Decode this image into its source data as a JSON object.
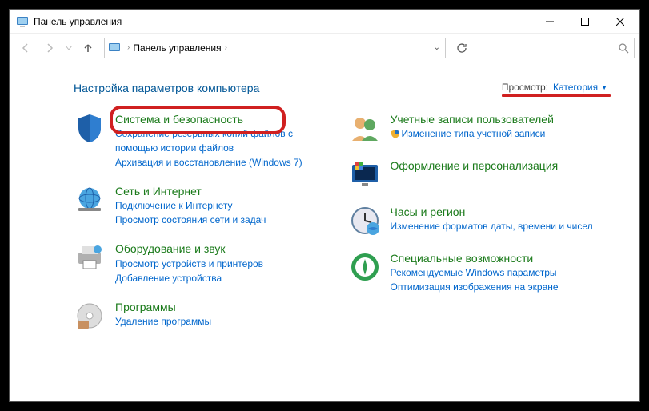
{
  "window": {
    "title": "Панель управления"
  },
  "breadcrumb": {
    "root": "Панель управления"
  },
  "page": {
    "heading": "Настройка параметров компьютера",
    "view_label": "Просмотр:",
    "view_value": "Категория"
  },
  "left": [
    {
      "title": "Система и безопасность",
      "links": [
        "Сохранение резервных копий файлов с помощью истории файлов",
        "Архивация и восстановление (Windows 7)"
      ],
      "highlighted": true
    },
    {
      "title": "Сеть и Интернет",
      "links": [
        "Подключение к Интернету",
        "Просмотр состояния сети и задач"
      ]
    },
    {
      "title": "Оборудование и звук",
      "links": [
        "Просмотр устройств и принтеров",
        "Добавление устройства"
      ]
    },
    {
      "title": "Программы",
      "links": [
        "Удаление программы"
      ]
    }
  ],
  "right": [
    {
      "title": "Учетные записи пользователей",
      "links": [
        "Изменение типа учетной записи"
      ],
      "shield": [
        true
      ]
    },
    {
      "title": "Оформление и персонализация",
      "links": []
    },
    {
      "title": "Часы и регион",
      "links": [
        "Изменение форматов даты, времени и чисел"
      ]
    },
    {
      "title": "Специальные возможности",
      "links": [
        "Рекомендуемые Windows параметры",
        "Оптимизация изображения на экране"
      ]
    }
  ]
}
